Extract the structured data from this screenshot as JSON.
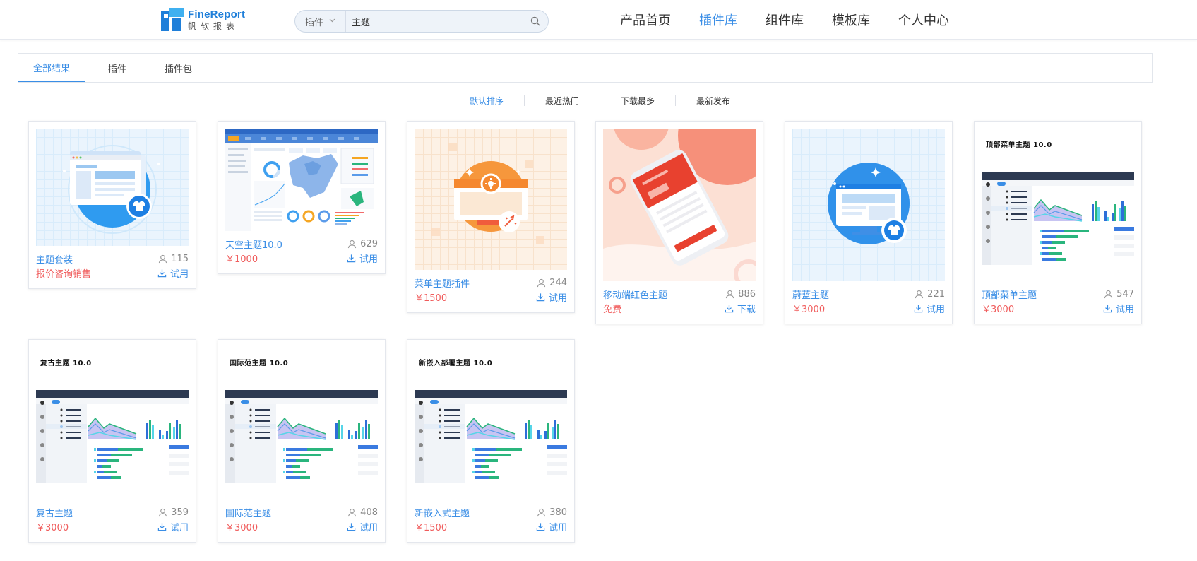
{
  "logo": {
    "en": "FineReport",
    "cn": "帆软报表"
  },
  "search": {
    "type": "插件",
    "value": "主题"
  },
  "nav": [
    "产品首页",
    "插件库",
    "组件库",
    "模板库",
    "个人中心"
  ],
  "tabs": [
    "全部结果",
    "插件",
    "插件包"
  ],
  "sort": [
    "默认排序",
    "最近热门",
    "下载最多",
    "最新发布"
  ],
  "cards": [
    {
      "name": "主题套装",
      "price": "报价咨询销售",
      "count": "115",
      "action": "试用"
    },
    {
      "name": "天空主题10.0",
      "price": "￥1000",
      "count": "629",
      "action": "试用"
    },
    {
      "name": "菜单主题插件",
      "price": "￥1500",
      "count": "244",
      "action": "试用"
    },
    {
      "name": "移动端红色主题",
      "price": "免费",
      "count": "886",
      "action": "下载"
    },
    {
      "name": "蔚蓝主题",
      "price": "￥3000",
      "count": "221",
      "action": "试用"
    },
    {
      "name": "顶部菜单主题",
      "price": "￥3000",
      "count": "547",
      "action": "试用",
      "thumb_title": "顶部菜单主题 10.0"
    },
    {
      "name": "复古主题",
      "price": "￥3000",
      "count": "359",
      "action": "试用",
      "thumb_title": "复古主题 10.0"
    },
    {
      "name": "国际范主题",
      "price": "￥3000",
      "count": "408",
      "action": "试用",
      "thumb_title": "国际范主题 10.0"
    },
    {
      "name": "新嵌入式主题",
      "price": "￥1500",
      "count": "380",
      "action": "试用",
      "thumb_title": "新嵌入部署主题 10.0"
    }
  ]
}
